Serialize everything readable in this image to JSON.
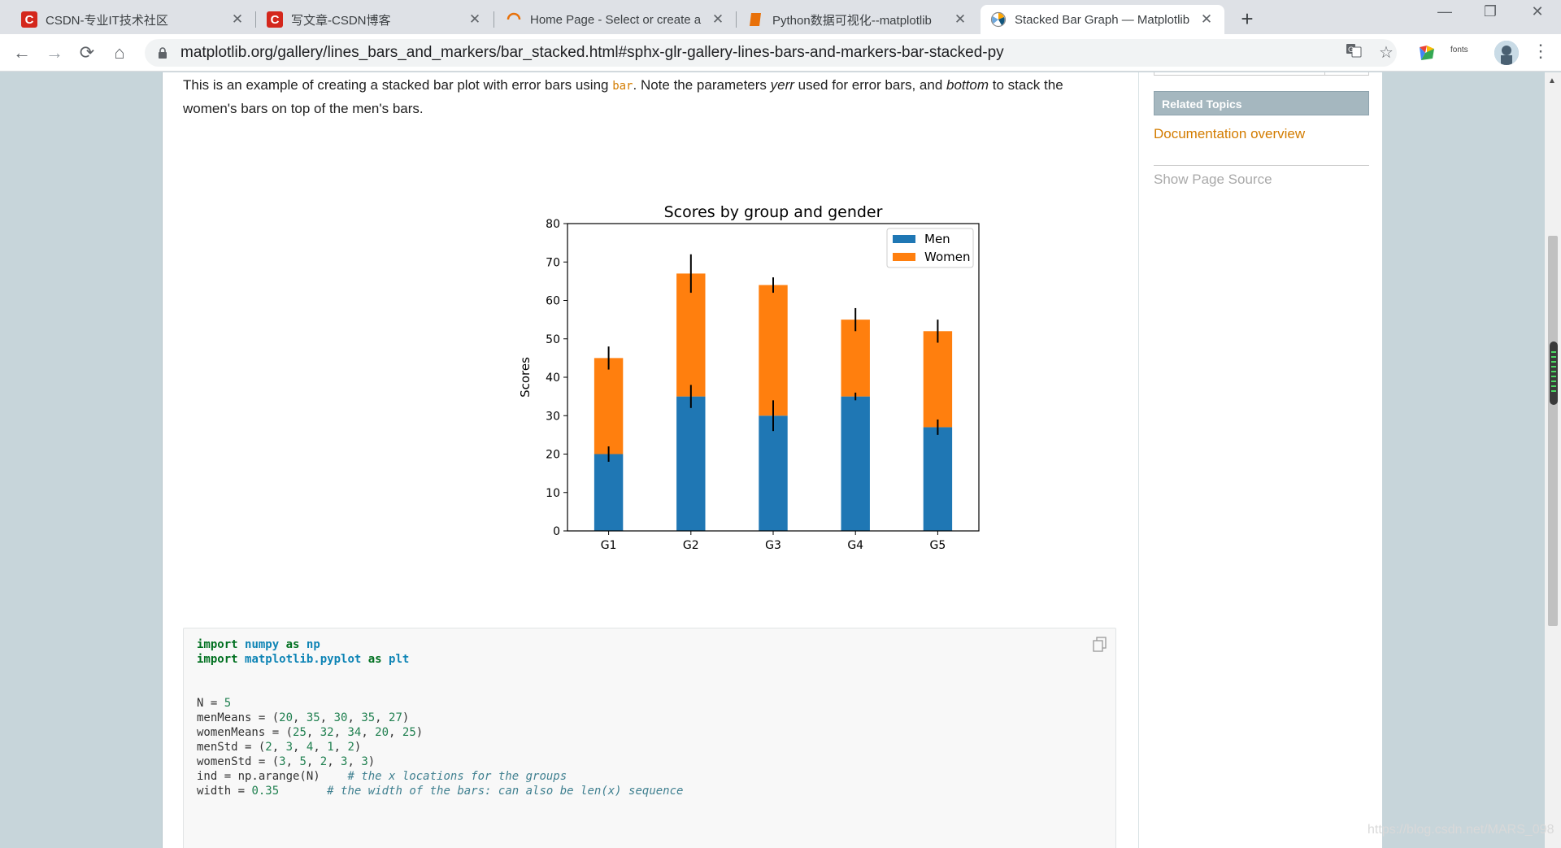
{
  "browser": {
    "tabs": [
      {
        "title": "CSDN-专业IT技术社区",
        "icon": "csdn-icon",
        "active": false
      },
      {
        "title": "写文章-CSDN博客",
        "icon": "csdn-icon",
        "active": false
      },
      {
        "title": "Home Page - Select or create a",
        "icon": "loading-icon",
        "active": false
      },
      {
        "title": "Python数据可视化--matplotlib",
        "icon": "book-icon",
        "active": false
      },
      {
        "title": "Stacked Bar Graph — Matplotlib",
        "icon": "matplotlib-icon",
        "active": true
      }
    ],
    "url": "matplotlib.org/gallery/lines_bars_and_markers/bar_stacked.html#sphx-glr-gallery-lines-bars-and-markers-bar-stacked-py",
    "fonts_ext_label": "fonts"
  },
  "intro": {
    "before": "This is an example of creating a stacked bar plot with error bars using ",
    "code": "bar",
    "mid1": ". Note the parameters ",
    "em1": "yerr",
    "mid2": " used for error bars, and ",
    "em2": "bottom",
    "after": " to stack the women's bars on top of the men's bars."
  },
  "sidebar": {
    "related_title": "Related Topics",
    "doc_link": "Documentation overview",
    "show_source": "Show Page Source"
  },
  "chart_data": {
    "type": "bar",
    "title": "Scores by group and gender",
    "xlabel": "",
    "ylabel": "Scores",
    "categories": [
      "G1",
      "G2",
      "G3",
      "G4",
      "G5"
    ],
    "series": [
      {
        "name": "Men",
        "values": [
          20,
          35,
          30,
          35,
          27
        ],
        "err": [
          2,
          3,
          4,
          1,
          2
        ],
        "color": "#1f77b4"
      },
      {
        "name": "Women",
        "values": [
          25,
          32,
          34,
          20,
          25
        ],
        "err": [
          3,
          5,
          2,
          3,
          3
        ],
        "color": "#ff7f0e"
      }
    ],
    "stacked": true,
    "ylim": [
      0,
      80
    ],
    "yticks": [
      0,
      10,
      20,
      30,
      40,
      50,
      60,
      70,
      80
    ],
    "legend_position": "top-right"
  },
  "code": {
    "lines": [
      "import numpy as np",
      "import matplotlib.pyplot as plt",
      "",
      "",
      "N = 5",
      "menMeans = (20, 35, 30, 35, 27)",
      "womenMeans = (25, 32, 34, 20, 25)",
      "menStd = (2, 3, 4, 1, 2)",
      "womenStd = (3, 5, 2, 3, 3)",
      "ind = np.arange(N)    # the x locations for the groups",
      "width = 0.35       # the width of the bars: can also be len(x) sequence"
    ]
  },
  "watermark": "https://blog.csdn.net/MARS_098"
}
